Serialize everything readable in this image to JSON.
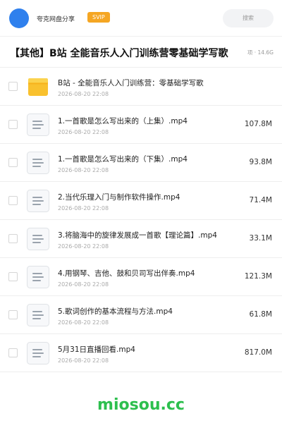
{
  "header": {
    "site_name": "夸克网盘分享",
    "vip_label": "SVIP",
    "search_label": "搜索"
  },
  "folder": {
    "title": "【其他】B站 全能音乐人入门训练营零基础学写歌",
    "meta": "项 · 14.6G"
  },
  "files": [
    {
      "name": "B站 - 全能音乐人入门训练营：零基础学写歌",
      "date": "2026-08-20 22:08",
      "size": "",
      "type": "folder"
    },
    {
      "name": "1.一首歌是怎么写出来的（上集）.mp4",
      "date": "2026-08-20 22:08",
      "size": "107.8M",
      "type": "file"
    },
    {
      "name": "1.一首歌是怎么写出来的（下集）.mp4",
      "date": "2026-08-20 22:08",
      "size": "93.8M",
      "type": "file"
    },
    {
      "name": "2.当代乐理入门与制作软件操作.mp4",
      "date": "2026-08-20 22:08",
      "size": "71.4M",
      "type": "file"
    },
    {
      "name": "3.将脑海中的旋律发展成一首歌【理论篇】.mp4",
      "date": "2026-08-20 22:08",
      "size": "33.1M",
      "type": "file"
    },
    {
      "name": "4.用钢琴、吉他、鼓和贝司写出伴奏.mp4",
      "date": "2026-08-20 22:08",
      "size": "121.3M",
      "type": "file"
    },
    {
      "name": "5.歌词创作的基本流程与方法.mp4",
      "date": "2026-08-20 22:08",
      "size": "61.8M",
      "type": "file"
    },
    {
      "name": "5月31日直播回看.mp4",
      "date": "2026-08-20 22:08",
      "size": "817.0M",
      "type": "file"
    }
  ],
  "footer": {
    "brand": "miosou.cc"
  },
  "colors": {
    "accent_blue": "#2f80ed",
    "vip_orange": "#f5a623",
    "folder_yellow": "#f9c12e",
    "brand_green": "#2dbf4e"
  }
}
